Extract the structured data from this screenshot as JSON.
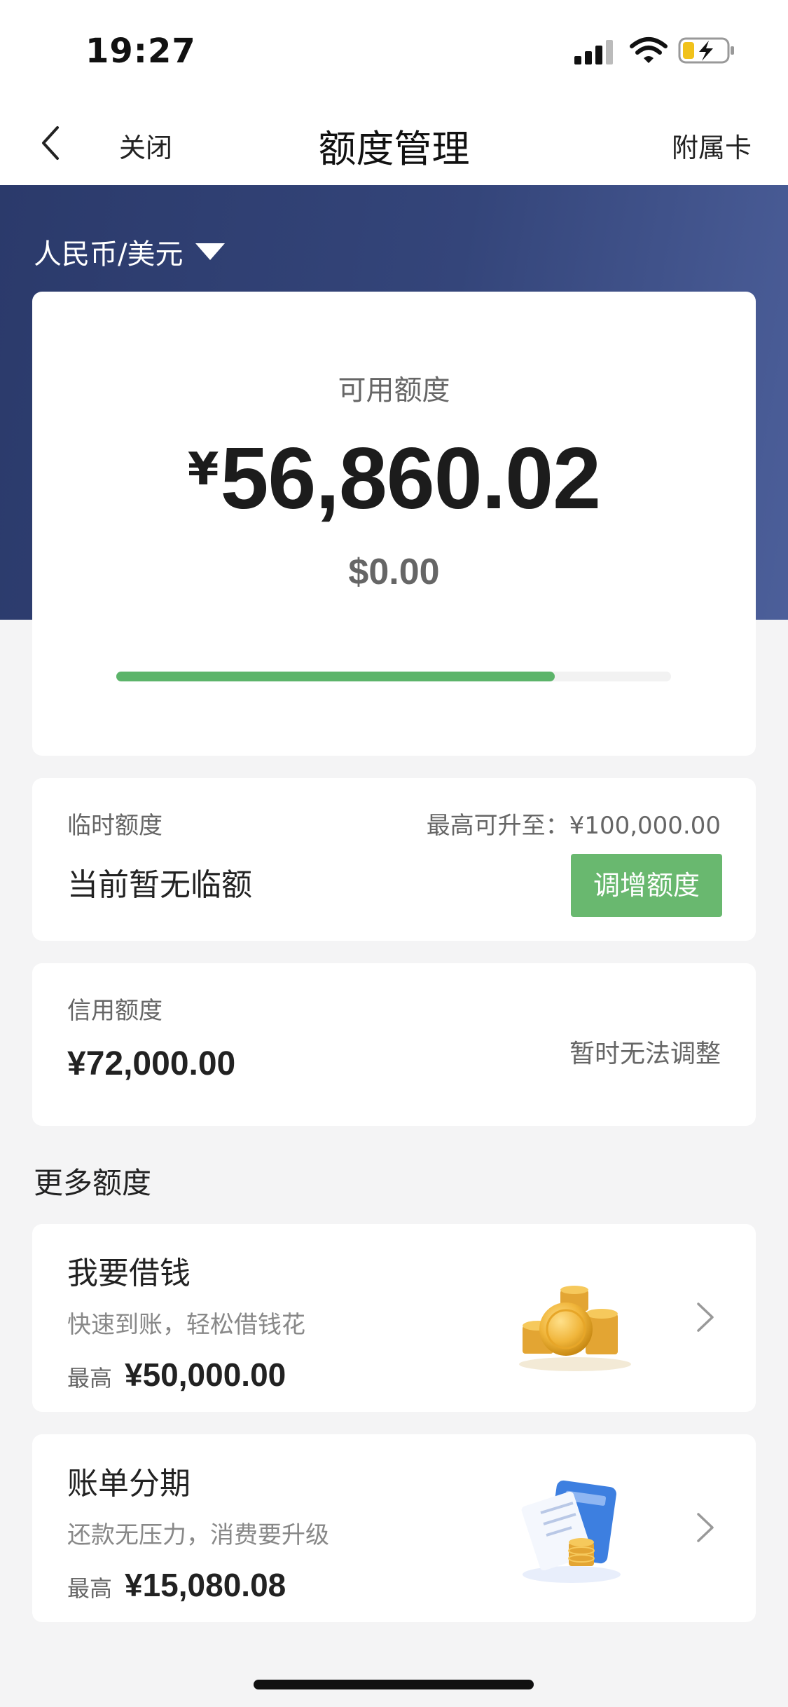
{
  "status_bar": {
    "time": "19:27"
  },
  "nav": {
    "close_label": "关闭",
    "title": "额度管理",
    "right_label": "附属卡"
  },
  "currency": {
    "label": "人民币/美元"
  },
  "available": {
    "label": "可用额度",
    "symbol": "¥",
    "amount": "56,860.02",
    "usd": "$0.00",
    "progress_ratio": 0.79
  },
  "temporary": {
    "label": "临时额度",
    "max_text": "最高可升至：¥100,000.00",
    "status": "当前暂无临额",
    "button": "调增额度"
  },
  "credit": {
    "label": "信用额度",
    "amount": "¥72,000.00",
    "status": "暂时无法调整"
  },
  "more": {
    "title": "更多额度",
    "items": [
      {
        "title": "我要借钱",
        "subtitle": "快速到账，轻松借钱花",
        "max_label": "最高",
        "max_value": "¥50,000.00",
        "icon": "gold-coins-icon"
      },
      {
        "title": "账单分期",
        "subtitle": "还款无压力，消费要升级",
        "max_label": "最高",
        "max_value": "¥15,080.08",
        "icon": "bill-card-coins-icon"
      }
    ]
  },
  "colors": {
    "hero": "#34457a",
    "accent_green": "#69b86f",
    "progress_green": "#5cb46a"
  }
}
